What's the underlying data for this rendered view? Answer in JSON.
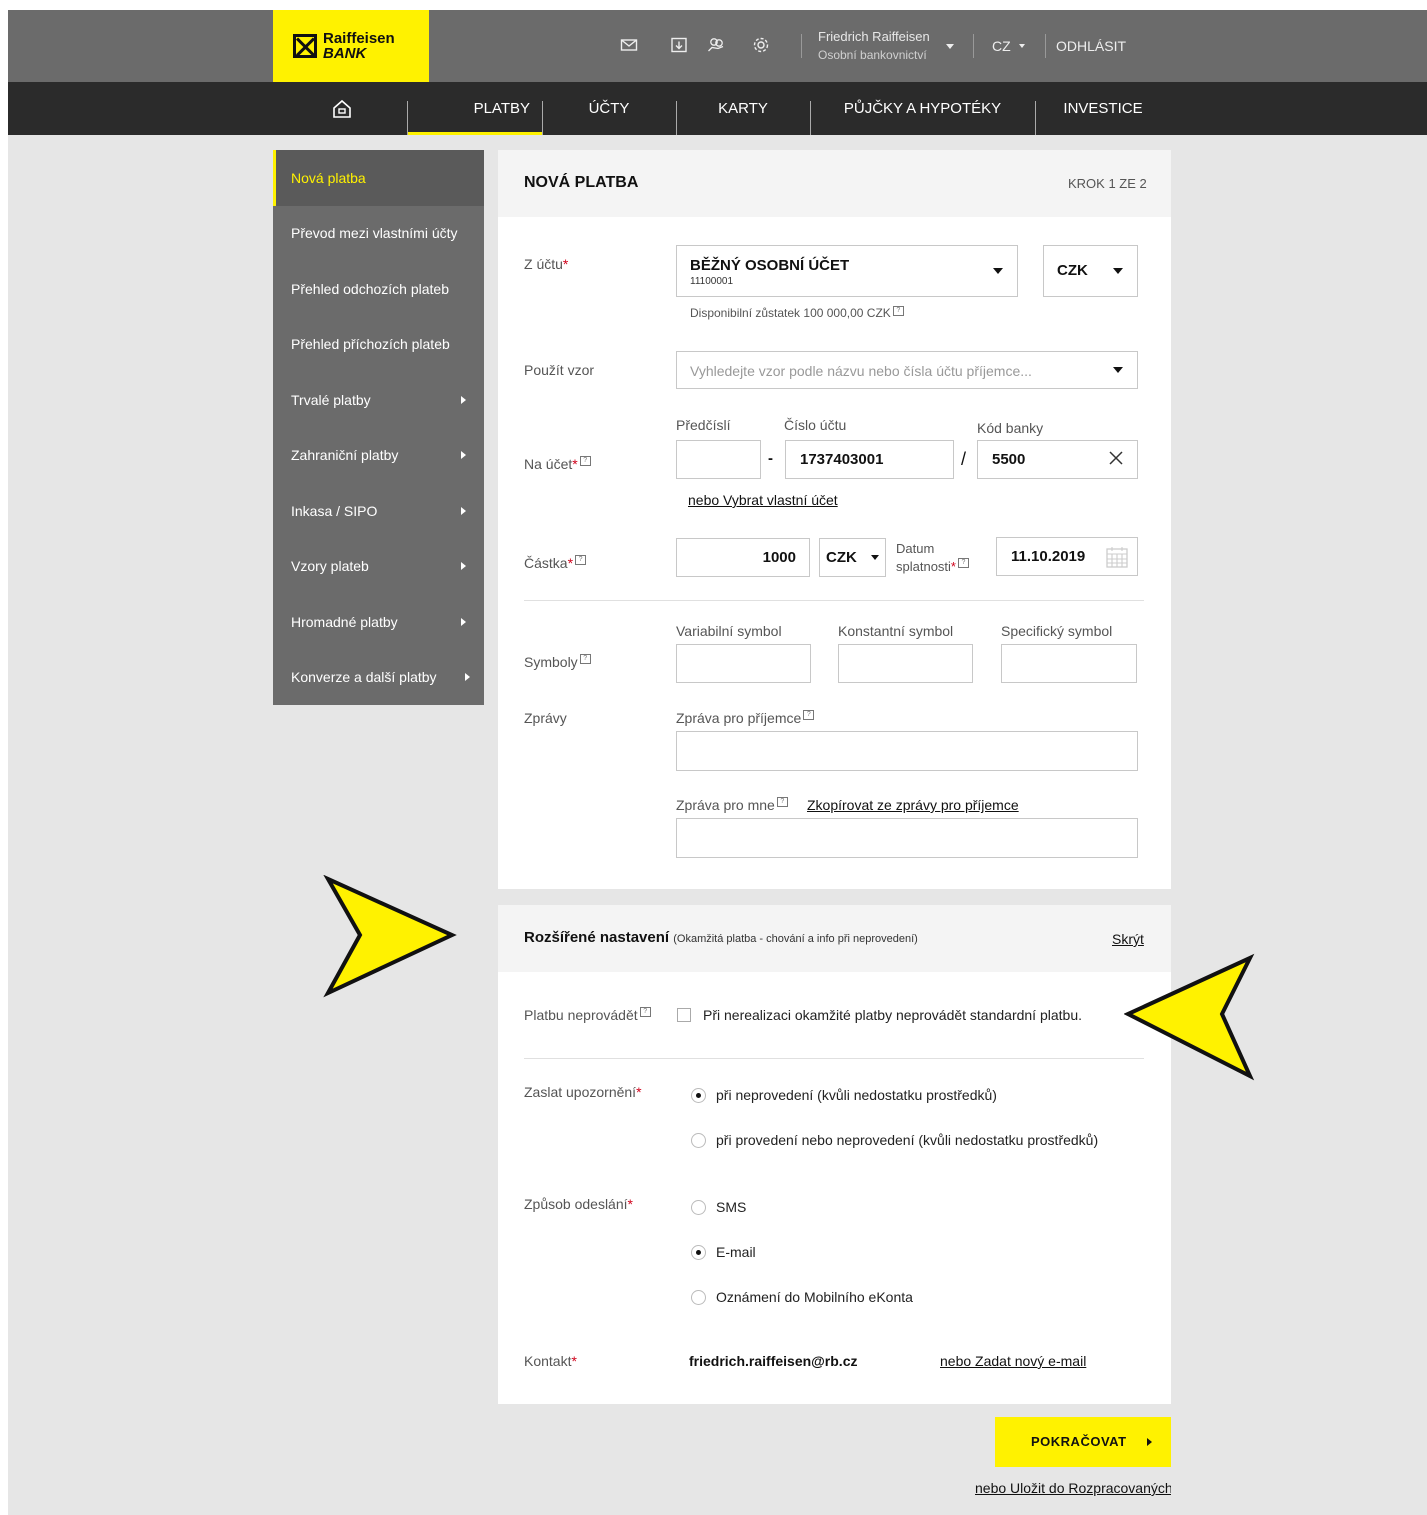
{
  "brand": {
    "name_line1": "Raiffeisen",
    "name_line2": "BANK"
  },
  "topbar": {
    "icons": [
      "mail-icon",
      "download-icon",
      "hand-coins-icon",
      "gear-icon"
    ],
    "user_name": "Friedrich Raiffeisen",
    "user_sub": "Osobní bankovnictví",
    "language": "CZ",
    "logout": "ODHLÁSIT"
  },
  "nav": {
    "items": [
      "PLATBY",
      "ÚČTY",
      "KARTY",
      "PŮJČKY A HYPOTÉKY",
      "INVESTICE"
    ],
    "active": "PLATBY"
  },
  "sidebar": {
    "items": [
      {
        "label": "Nová platba"
      },
      {
        "label": "Převod mezi vlastními účty"
      },
      {
        "label": "Přehled odchozích plateb"
      },
      {
        "label": "Přehled příchozích plateb"
      },
      {
        "label": "Trvalé platby"
      },
      {
        "label": "Zahraniční platby"
      },
      {
        "label": "Inkasa / SIPO"
      },
      {
        "label": "Vzory plateb"
      },
      {
        "label": "Hromadné platby"
      },
      {
        "label": "Konverze a další platby"
      }
    ]
  },
  "form": {
    "title": "NOVÁ PLATBA",
    "step": "KROK 1 ZE 2",
    "from_label": "Z účtu",
    "from_account_name": "BĚŽNÝ OSOBNÍ ÚČET",
    "from_account_number": "11100001",
    "from_currency": "CZK",
    "balance": "Disponibilní zůstatek 100 000,00 CZK",
    "template_label": "Použít vzor",
    "template_placeholder": "Vyhledejte vzor podle názvu nebo čísla účtu příjemce...",
    "to_label": "Na účet",
    "prefix_label": "Předčíslí",
    "prefix_value": "",
    "account_label": "Číslo účtu",
    "account_value": "1737403001",
    "bank_label": "Kód banky",
    "bank_value": "5500",
    "own_account_link": "nebo Vybrat vlastní účet",
    "amount_label": "Částka",
    "amount_value": "1000",
    "amount_currency": "CZK",
    "due_label_1": "Datum",
    "due_label_2": "splatnosti",
    "due_value": "11.10.2019",
    "symbols_label": "Symboly",
    "vs_label": "Variabilní symbol",
    "ks_label": "Konstantní symbol",
    "ss_label": "Specifický symbol",
    "messages_label": "Zprávy",
    "msg_recipient_label": "Zpráva pro příjemce",
    "msg_me_label": "Zpráva pro mne",
    "copy_link": "Zkopírovat ze zprávy pro příjemce"
  },
  "advanced": {
    "title": "Rozšířené nastavení",
    "subtitle": "(Okamžitá platba - chování a info při neprovedení)",
    "hide_link": "Skrýt",
    "skip_label": "Platbu neprovádět",
    "skip_checkbox": "Při nerealizaci okamžité platby neprovádět standardní platbu.",
    "skip_checked": false,
    "notify_label": "Zaslat upozornění",
    "notify_options": [
      "při neprovedení (kvůli nedostatku prostředků)",
      "při provedení nebo neprovedení (kvůli nedostatku prostředků)"
    ],
    "notify_selected": 0,
    "send_label": "Způsob odeslání",
    "send_options": [
      "SMS",
      "E-mail",
      "Oznámení do Mobilního eKonta"
    ],
    "send_selected": 1,
    "contact_label": "Kontakt",
    "contact_value": "friedrich.raiffeisen@rb.cz",
    "new_email_link": "nebo Zadat nový e-mail"
  },
  "actions": {
    "continue": "POKRAČOVAT",
    "save_draft": "nebo Uložit do Rozpracovaných"
  },
  "colors": {
    "brand_yellow": "#fff200",
    "topbar": "#6b6b6b",
    "navbar": "#2b2b2b",
    "required": "#d0021b"
  }
}
